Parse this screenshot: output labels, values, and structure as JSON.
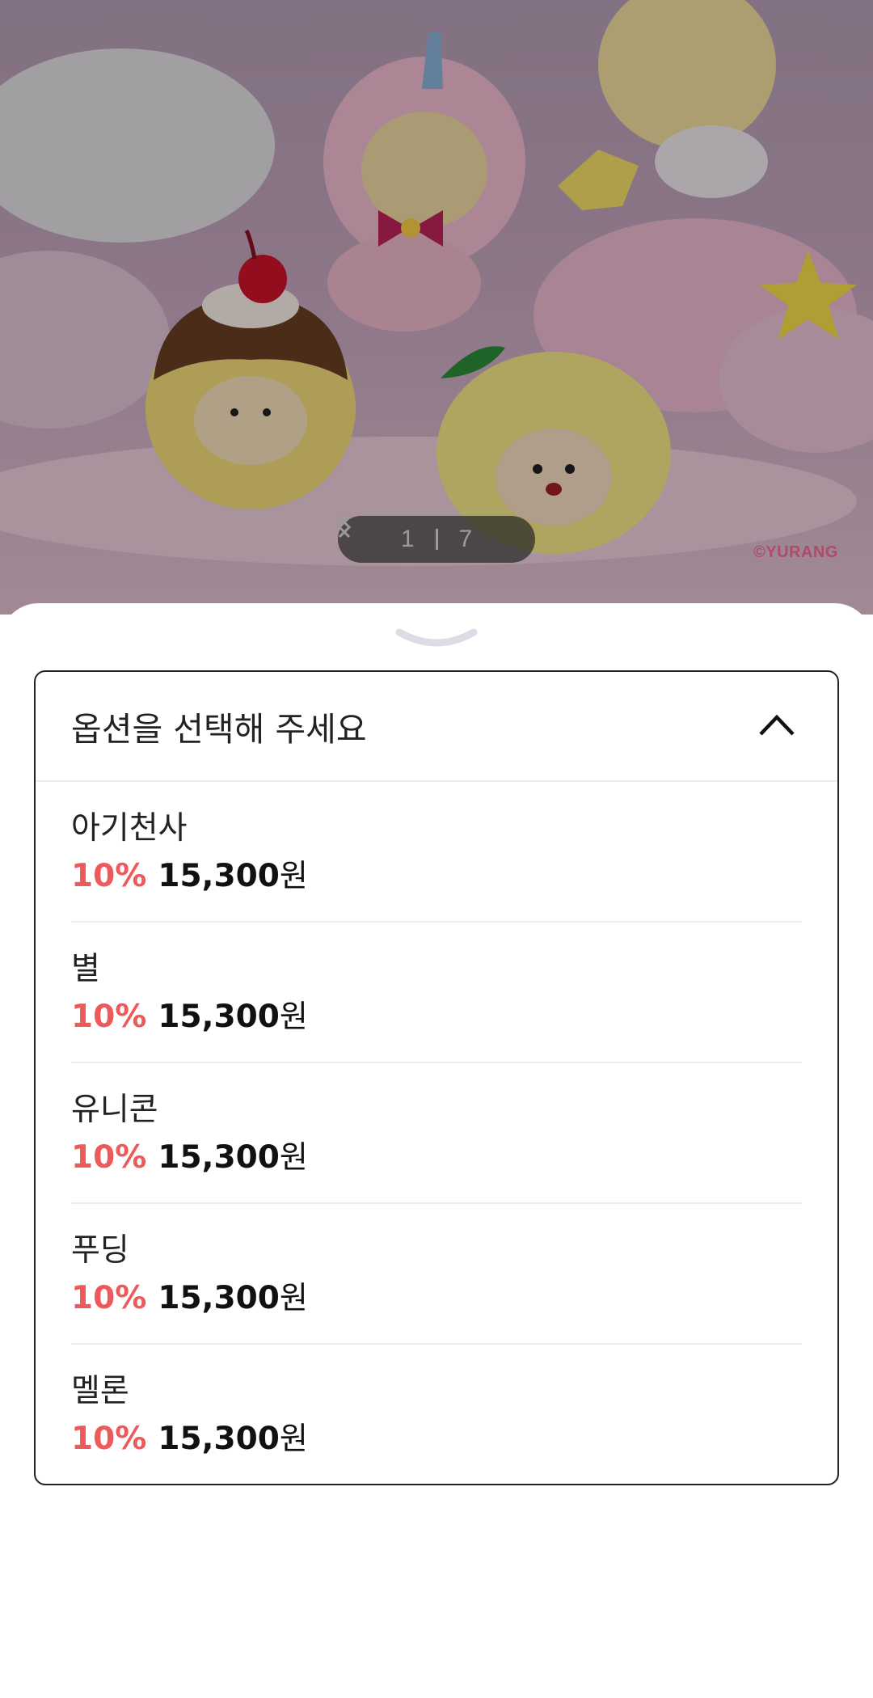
{
  "carousel": {
    "current": "1",
    "total": "7",
    "prev_icon": "chevron-left-icon",
    "next_icon": "chevron-right-icon",
    "credit": "©YURANG"
  },
  "option_select": {
    "placeholder": "옵션을 선택해 주세요",
    "toggle_icon": "chevron-up-icon",
    "options": [
      {
        "name": "아기천사",
        "discount": "10%",
        "price": "15,300",
        "unit": "원"
      },
      {
        "name": "별",
        "discount": "10%",
        "price": "15,300",
        "unit": "원"
      },
      {
        "name": "유니콘",
        "discount": "10%",
        "price": "15,300",
        "unit": "원"
      },
      {
        "name": "푸딩",
        "discount": "10%",
        "price": "15,300",
        "unit": "원"
      },
      {
        "name": "멜론",
        "discount": "10%",
        "price": "15,300",
        "unit": "원"
      }
    ]
  },
  "colors": {
    "discount": "#ee5a5a",
    "border": "#222222",
    "divider": "#eeeeee"
  }
}
